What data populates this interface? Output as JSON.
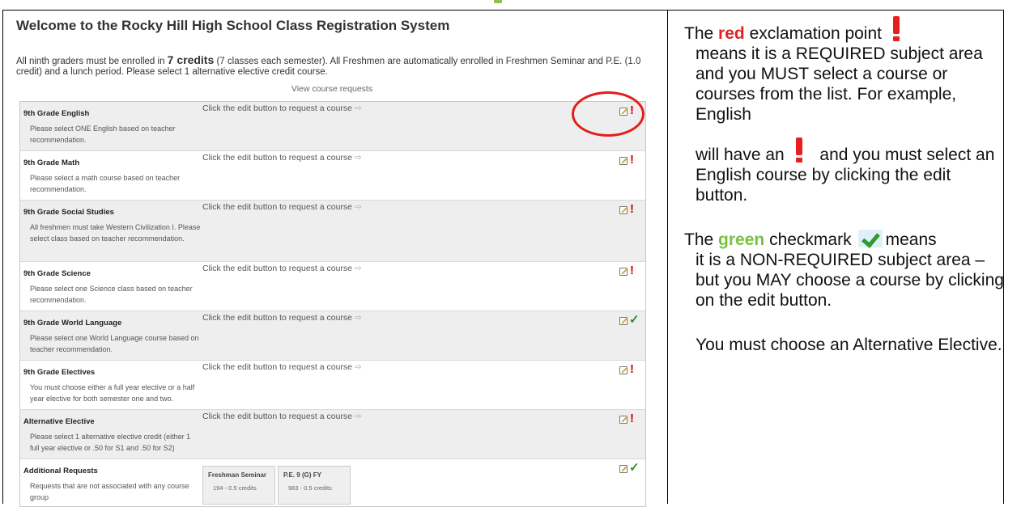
{
  "page": {
    "title": "Welcome to the Rocky Hill High School Class Registration System",
    "intro": {
      "part1": "All ninth graders must be enrolled in",
      "credits": "7 credits",
      "part2": "(7 classes each semester). All Freshmen are automatically enrolled in Freshmen Seminar and P.E. (1.0 credit) and a lunch period. Please select 1 alternative elective credit course."
    },
    "view_requests": "View course requests",
    "edit_hint": "Click the edit button to request a course",
    "rows": [
      {
        "name": "9th Grade English",
        "desc": "Please select ONE English based on teacher recommendation.",
        "mark": "!"
      },
      {
        "name": "9th Grade Math",
        "desc": "Please select a math course based on teacher recommendation.",
        "mark": "!"
      },
      {
        "name": "9th Grade Social Studies",
        "desc": "All freshmen must take Western Civilization I. Please select class based on teacher recommendation.",
        "mark": "!"
      },
      {
        "name": "9th Grade Science",
        "desc": "Please select one Science class based on teacher recommendation.",
        "mark": "!"
      },
      {
        "name": "9th Grade World Language",
        "desc": "Please select one World Language course based on teacher recommendation.",
        "mark": "✓"
      },
      {
        "name": "9th Grade Electives",
        "desc": "You must choose either a full year elective or a half year elective for both semester one and two.",
        "mark": "!"
      },
      {
        "name": "Alternative Elective",
        "desc": "Please select 1 alternative elective credit (either 1 full year elective or .50 for S1 and .50 for S2)",
        "mark": "!"
      },
      {
        "name": "Additional Requests",
        "desc": "Requests that are not associated with any course group",
        "mark": "✓"
      }
    ],
    "courses": [
      {
        "title": "Freshman Seminar",
        "sub": "194 - 0.5 credits"
      },
      {
        "title": "P.E. 9 (G) FY",
        "sub": "983 - 0.5 credits"
      }
    ]
  },
  "legend": {
    "red_p1": "The",
    "red_word": "red",
    "red_p2": "exclamation point",
    "red_body": "means it is a REQUIRED subject area and you MUST select a course or courses from the list.  For example, English",
    "red_will": "will have an",
    "red_end": "and you must select an English course by clicking the edit button.",
    "green_p1": "The",
    "green_word": "green",
    "green_p2": "checkmark",
    "green_means": "means",
    "green_body": "it is a NON-REQUIRED subject area – but you MAY choose a course by clicking on the edit button.",
    "alt": "You must choose an Alternative Elective."
  },
  "colors": {
    "required": "#e02424",
    "optional": "#7ac143",
    "oval": "#e51b1b"
  }
}
